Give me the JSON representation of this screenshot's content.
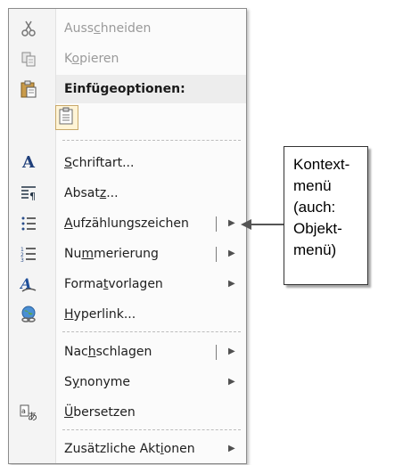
{
  "menu": {
    "items": [
      {
        "pre": "Auss",
        "ul": "c",
        "post": "hneiden",
        "icon": "scissors-icon",
        "glyph": "✂",
        "state": "disabled"
      },
      {
        "pre": "K",
        "ul": "o",
        "post": "pieren",
        "icon": "copy-icon",
        "glyph": "⎘",
        "state": "disabled"
      },
      {
        "pre": "Einfügeoptionen:",
        "ul": "",
        "post": "",
        "icon": "paste-icon",
        "glyph": "📋",
        "state": "header"
      },
      {
        "pre": "",
        "ul": "S",
        "post": "chriftart...",
        "icon": "font-icon",
        "glyph": "A",
        "state": "normal"
      },
      {
        "pre": "Absat",
        "ul": "z",
        "post": "...",
        "icon": "paragraph-icon",
        "glyph": "¶",
        "state": "normal"
      },
      {
        "pre": "",
        "ul": "A",
        "post": "ufzählungszeichen",
        "icon": "bullets-icon",
        "glyph": "☰",
        "state": "normal",
        "submenu": "▶"
      },
      {
        "pre": "Nu",
        "ul": "m",
        "post": "merierung",
        "icon": "numbering-icon",
        "glyph": "☷",
        "state": "normal",
        "submenu": "▶"
      },
      {
        "pre": "Forma",
        "ul": "t",
        "post": "vorlagen",
        "icon": "styles-icon",
        "glyph": "A",
        "state": "normal",
        "submenu": "▶"
      },
      {
        "pre": "",
        "ul": "H",
        "post": "yperlink...",
        "icon": "hyperlink-icon",
        "glyph": "🌐",
        "state": "normal"
      },
      {
        "pre": "Nac",
        "ul": "h",
        "post": "schlagen",
        "icon": "",
        "glyph": "",
        "state": "normal",
        "submenu": "▶"
      },
      {
        "pre": "S",
        "ul": "y",
        "post": "nonyme",
        "icon": "",
        "glyph": "",
        "state": "normal",
        "submenu": "▶"
      },
      {
        "pre": "",
        "ul": "Ü",
        "post": "bersetzen",
        "icon": "translate-icon",
        "glyph": "あ",
        "state": "normal"
      },
      {
        "pre": "Zusätzliche Akt",
        "ul": "i",
        "post": "onen",
        "icon": "",
        "glyph": "",
        "state": "normal",
        "submenu": "▶"
      }
    ],
    "paste_option_icon": "keep-text-only-icon"
  },
  "callout": {
    "text": "Kontext-\nmenü\n(auch:\nObjekt-\nmenü)"
  },
  "colors": {
    "menu_bg": "#fbfbfb",
    "gutter": "#f4f4f4",
    "disabled_text": "#9a9a9a",
    "arrow": "#4a4a4a"
  }
}
